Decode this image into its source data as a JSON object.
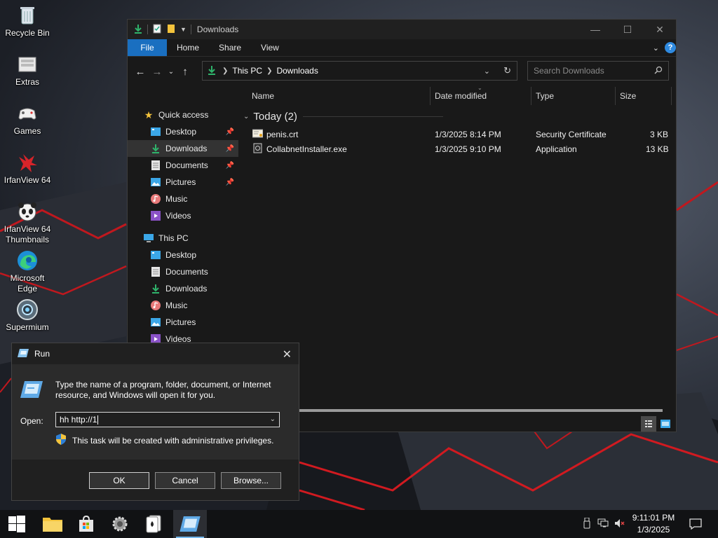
{
  "desktop": {
    "icons": [
      {
        "label": "Recycle Bin"
      },
      {
        "label": "Extras"
      },
      {
        "label": "Games"
      },
      {
        "label": "IrfanView 64"
      },
      {
        "label": "IrfanView 64 Thumbnails"
      },
      {
        "label": "Microsoft Edge"
      },
      {
        "label": "Supermium"
      }
    ]
  },
  "explorer": {
    "title": "Downloads",
    "ribbon_tabs": [
      "File",
      "Home",
      "Share",
      "View"
    ],
    "address": {
      "crumbs": [
        "This PC",
        "Downloads"
      ]
    },
    "search_placeholder": "Search Downloads",
    "nav": {
      "quick_access": "Quick access",
      "quick_items": [
        "Desktop",
        "Downloads",
        "Documents",
        "Pictures",
        "Music",
        "Videos"
      ],
      "this_pc": "This PC",
      "pc_items": [
        "Desktop",
        "Documents",
        "Downloads",
        "Music",
        "Pictures",
        "Videos"
      ]
    },
    "columns": {
      "name": "Name",
      "date": "Date modified",
      "type": "Type",
      "size": "Size"
    },
    "group_label": "Today (2)",
    "files": [
      {
        "name": "penis.crt",
        "date": "1/3/2025 8:14 PM",
        "type": "Security Certificate",
        "size": "3 KB"
      },
      {
        "name": "CollabnetInstaller.exe",
        "date": "1/3/2025 9:10 PM",
        "type": "Application",
        "size": "13 KB"
      }
    ]
  },
  "run": {
    "title": "Run",
    "description": "Type the name of a program, folder, document, or Internet resource, and Windows will open it for you.",
    "open_label": "Open:",
    "open_value": "hh http://1",
    "admin_note": "This task will be created with administrative privileges.",
    "ok": "OK",
    "cancel": "Cancel",
    "browse": "Browse..."
  },
  "taskbar": {
    "time": "9:11:01 PM",
    "date": "1/3/2025"
  },
  "colors": {
    "accent": "#1a6fc0",
    "folder_yellow": "#f3c33c",
    "download_green": "#2fb36b"
  }
}
